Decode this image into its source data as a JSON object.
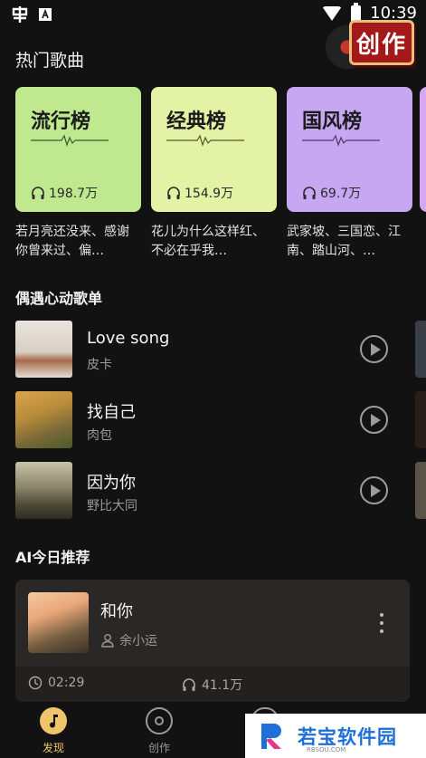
{
  "status_bar": {
    "time": "10:39"
  },
  "create_badge": {
    "label": "创作"
  },
  "hot_songs": {
    "title": "热门歌曲",
    "charts": [
      {
        "name": "流行榜",
        "plays": "198.7万",
        "desc": "若月亮还没来、感谢你曾来过、偏…",
        "color": "#bfe88f"
      },
      {
        "name": "经典榜",
        "plays": "154.9万",
        "desc": "花儿为什么这样红、不必在乎我…",
        "color": "#e4f2a6"
      },
      {
        "name": "国风榜",
        "plays": "69.7万",
        "desc": "武家坡、三国恋、江南、踏山河、…",
        "color": "#c7a6f2"
      }
    ]
  },
  "playlist": {
    "title": "偶遇心动歌单",
    "items": [
      {
        "title": "Love song",
        "artist": "皮卡"
      },
      {
        "title": "找自己",
        "artist": "肉包"
      },
      {
        "title": "因为你",
        "artist": "野比大同"
      }
    ]
  },
  "ai": {
    "title": "AI今日推荐",
    "song": {
      "title": "和你",
      "artist": "余小运",
      "duration": "02:29",
      "plays": "41.1万"
    }
  },
  "nav": [
    {
      "label": "发现"
    },
    {
      "label": "创作"
    }
  ],
  "watermark": {
    "text": "若宝软件园",
    "sub": "RBSOU.COM"
  }
}
